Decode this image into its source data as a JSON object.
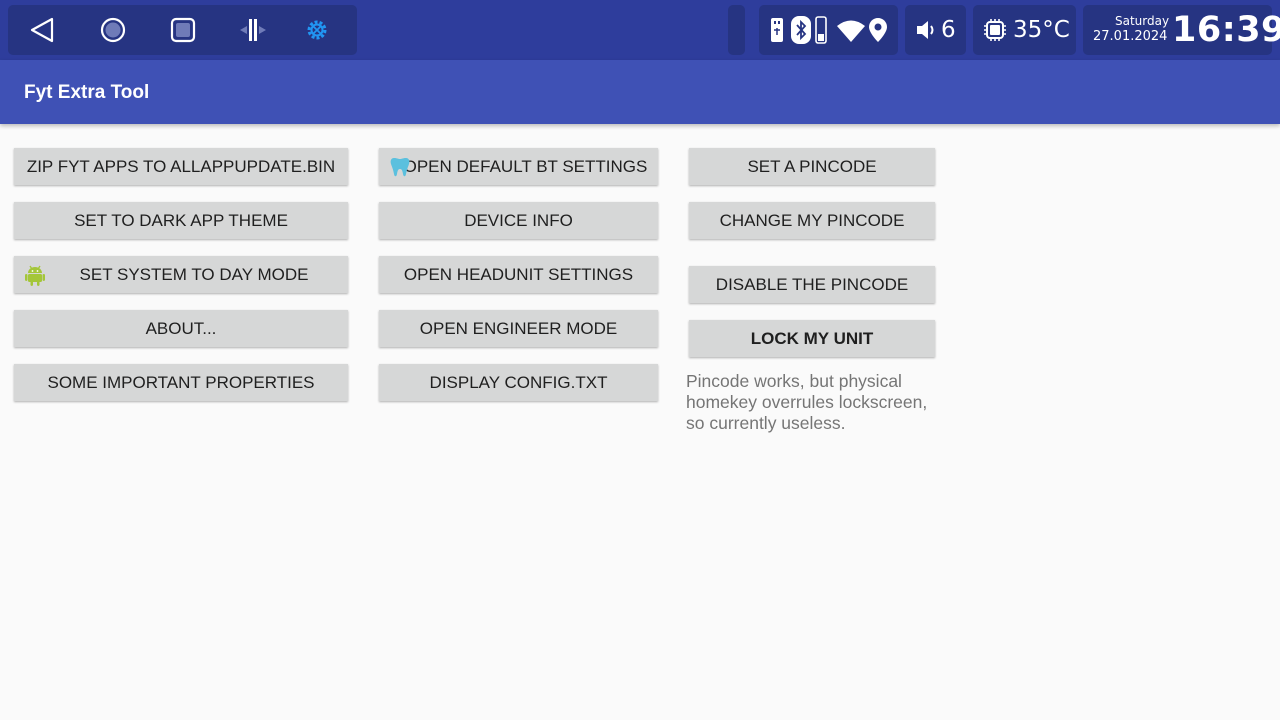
{
  "status_bar": {
    "nav_icons": [
      "back-triangle-icon",
      "home-circle-icon",
      "recents-square-icon",
      "split-screen-icon",
      "settings-gear-icon"
    ],
    "connectivity_icons": [
      "usb-icon",
      "bluetooth-icon",
      "phone-icon",
      "wifi-icon",
      "location-icon"
    ],
    "volume": "6",
    "temperature": "35°C",
    "day": "Saturday",
    "date": "27.01.2024",
    "time": "16:39",
    "accent_color": "#2196f3"
  },
  "app": {
    "title": "Fyt Extra Tool"
  },
  "buttons": {
    "zip_apps": "ZIP FYT APPS TO ALLAPPUPDATE.BIN",
    "dark_theme": "SET TO DARK APP THEME",
    "day_mode": "SET SYSTEM TO DAY MODE",
    "about": "ABOUT...",
    "properties": "SOME IMPORTANT PROPERTIES",
    "bt_settings": "OPEN DEFAULT BT SETTINGS",
    "device_info": "DEVICE INFO",
    "headunit_settings": "OPEN HEADUNIT SETTINGS",
    "engineer_mode": "OPEN ENGINEER MODE",
    "display_config": "DISPLAY CONFIG.TXT",
    "set_pincode": "SET A PINCODE",
    "change_pincode": "CHANGE MY PINCODE",
    "disable_pincode": "DISABLE THE PINCODE",
    "lock_unit": "LOCK MY UNIT"
  },
  "pincode_note": "Pincode works, but physical homekey overrules lockscreen, so currently useless.",
  "button_icons": {
    "day_mode": "android-robot-icon",
    "bt_settings": "tooth-icon"
  },
  "colors": {
    "status_bar": "#2e3d9c",
    "app_bar": "#3f51b5",
    "button": "#d6d7d7",
    "android_green": "#a4c639",
    "tooth_blue": "#5bc0de"
  }
}
